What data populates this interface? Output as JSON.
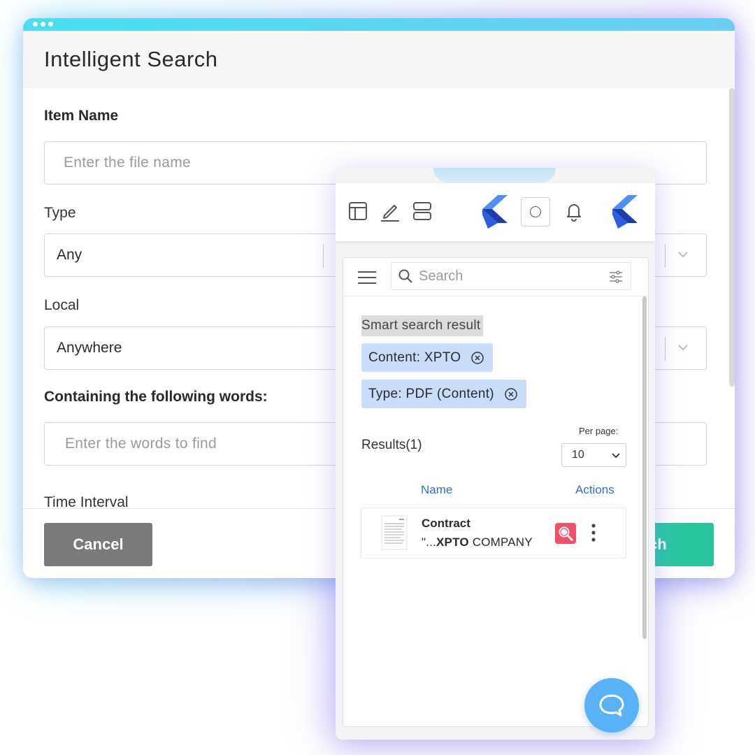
{
  "search_form": {
    "title": "Intelligent Search",
    "item_name": {
      "label": "Item Name",
      "placeholder": "Enter the file name"
    },
    "type": {
      "label": "Type",
      "value": "Any"
    },
    "local": {
      "label": "Local",
      "value": "Anywhere"
    },
    "words": {
      "label": "Containing the following words:",
      "placeholder": "Enter the words to find"
    },
    "time_interval": {
      "label": "Time Interval"
    },
    "cancel_label": "Cancel",
    "search_label": "Search"
  },
  "mobile_app": {
    "toolbar": {
      "icons": [
        "layout-icon",
        "edit-icon",
        "storage-icon",
        "logo",
        "circle-button",
        "bell-icon",
        "logo"
      ]
    },
    "search": {
      "placeholder": "Search"
    },
    "smart_search_label": "Smart search result",
    "filters": [
      {
        "label": "Content: XPTO"
      },
      {
        "label": "Type: PDF (Content)"
      }
    ],
    "results_label": "Results(1)",
    "per_page": {
      "label": "Per page:",
      "value": "10"
    },
    "columns": {
      "name": "Name",
      "actions": "Actions"
    },
    "results": [
      {
        "title": "Contract",
        "snippet_prefix": "\"...",
        "snippet_bold": "XPTO",
        "snippet_suffix": " COMPANY"
      }
    ]
  },
  "colors": {
    "accent_blue": "#2e6fd4",
    "chip_bg": "#c9ddfb",
    "search_button": "#28c49a",
    "cancel_button": "#7a7a7a",
    "fab": "#59b2f5",
    "ocr_icon": "#f0506a"
  }
}
